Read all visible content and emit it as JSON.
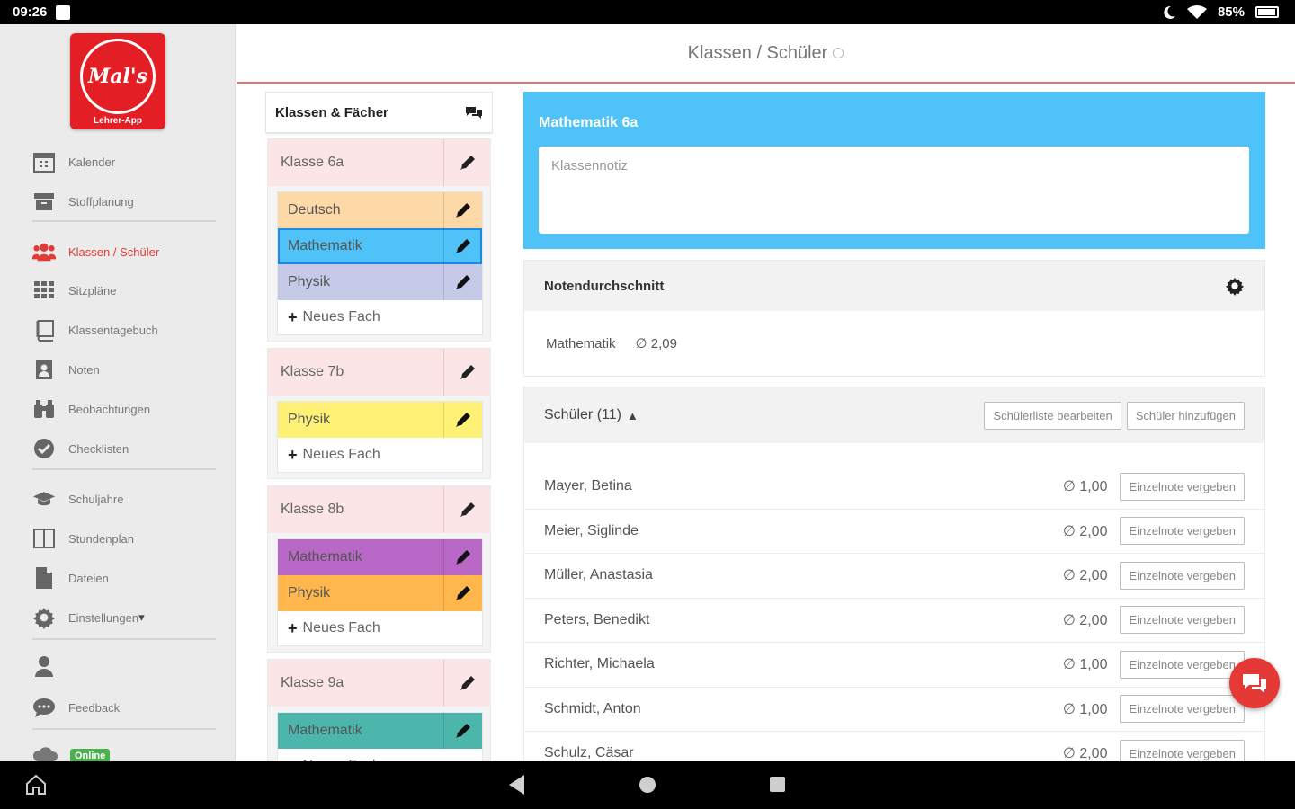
{
  "status_bar": {
    "time": "09:26",
    "battery": "85%",
    "battery_level": 0.85
  },
  "app": {
    "logo_text": "Mal's",
    "logo_subtitle": "Lehrer-App",
    "online_label": "Online"
  },
  "header": {
    "title": "Klassen / Schüler"
  },
  "sidebar": {
    "items": [
      {
        "label": "Kalender",
        "icon": "calendar-icon"
      },
      {
        "label": "Stoffplanung",
        "icon": "archive-icon"
      },
      {
        "label": "Klassen / Schüler",
        "icon": "users-icon",
        "active": true
      },
      {
        "label": "Sitzpläne",
        "icon": "grid-icon"
      },
      {
        "label": "Klassentagebuch",
        "icon": "book-icon"
      },
      {
        "label": "Noten",
        "icon": "grades-icon"
      },
      {
        "label": "Beobachtungen",
        "icon": "binoculars-icon"
      },
      {
        "label": "Checklisten",
        "icon": "check-circle-icon"
      },
      {
        "label": "Schuljahre",
        "icon": "graduation-cap-icon"
      },
      {
        "label": "Stundenplan",
        "icon": "columns-icon"
      },
      {
        "label": "Dateien",
        "icon": "file-icon"
      },
      {
        "label": "Einstellungen",
        "icon": "gear-icon"
      },
      {
        "label": "",
        "icon": "user-icon"
      },
      {
        "label": "Feedback",
        "icon": "comment-icon"
      }
    ]
  },
  "classes_panel": {
    "title": "Klassen & Fächer",
    "new_subject_label": "Neues Fach",
    "classes": [
      {
        "name": "Klasse 6a",
        "subjects": [
          {
            "name": "Deutsch",
            "color": "#fdd9a8"
          },
          {
            "name": "Mathematik",
            "color": "#4fc3f7"
          },
          {
            "name": "Physik",
            "color": "#c5cae9"
          }
        ]
      },
      {
        "name": "Klasse 7b",
        "subjects": [
          {
            "name": "Physik",
            "color": "#fff176"
          }
        ]
      },
      {
        "name": "Klasse 8b",
        "subjects": [
          {
            "name": "Mathematik",
            "color": "#ba68c8"
          },
          {
            "name": "Physik",
            "color": "#ffb74d"
          }
        ]
      },
      {
        "name": "Klasse 9a",
        "subjects": [
          {
            "name": "Mathematik",
            "color": "#4db6ac"
          }
        ]
      }
    ]
  },
  "selected": {
    "title": "Mathematik 6a",
    "note_placeholder": "Klassennotiz"
  },
  "average": {
    "title": "Notendurchschnitt",
    "subject": "Mathematik",
    "value": "∅ 2,09"
  },
  "students": {
    "title": "Schüler (11)",
    "edit_button": "Schülerliste bearbeiten",
    "add_button": "Schüler hinzufügen",
    "grade_button": "Einzelnote vergeben",
    "list": [
      {
        "name": "Mayer, Betina",
        "avg": "∅ 1,00"
      },
      {
        "name": "Meier, Siglinde",
        "avg": "∅ 2,00"
      },
      {
        "name": "Müller, Anastasia",
        "avg": "∅ 2,00"
      },
      {
        "name": "Peters, Benedikt",
        "avg": "∅ 2,00"
      },
      {
        "name": "Richter, Michaela",
        "avg": "∅ 1,00"
      },
      {
        "name": "Schmidt, Anton",
        "avg": "∅ 1,00"
      },
      {
        "name": "Schulz, Cäsar",
        "avg": "∅ 2,00"
      }
    ]
  },
  "colors": {
    "accent": "#e53935",
    "selected_header": "#4fc3f7",
    "online": "#4caf50"
  }
}
